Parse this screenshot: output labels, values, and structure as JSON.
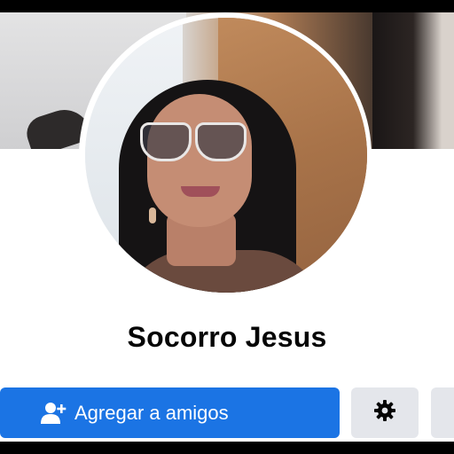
{
  "profile": {
    "name": "Socorro Jesus"
  },
  "actions": {
    "add_friend_label": "Agregar a amigos"
  },
  "colors": {
    "primary_button": "#1b74e4",
    "secondary_button": "#e4e6eb",
    "name_text": "#050505"
  },
  "icons": {
    "add_friend": "person-add-icon",
    "settings": "gear-icon"
  }
}
